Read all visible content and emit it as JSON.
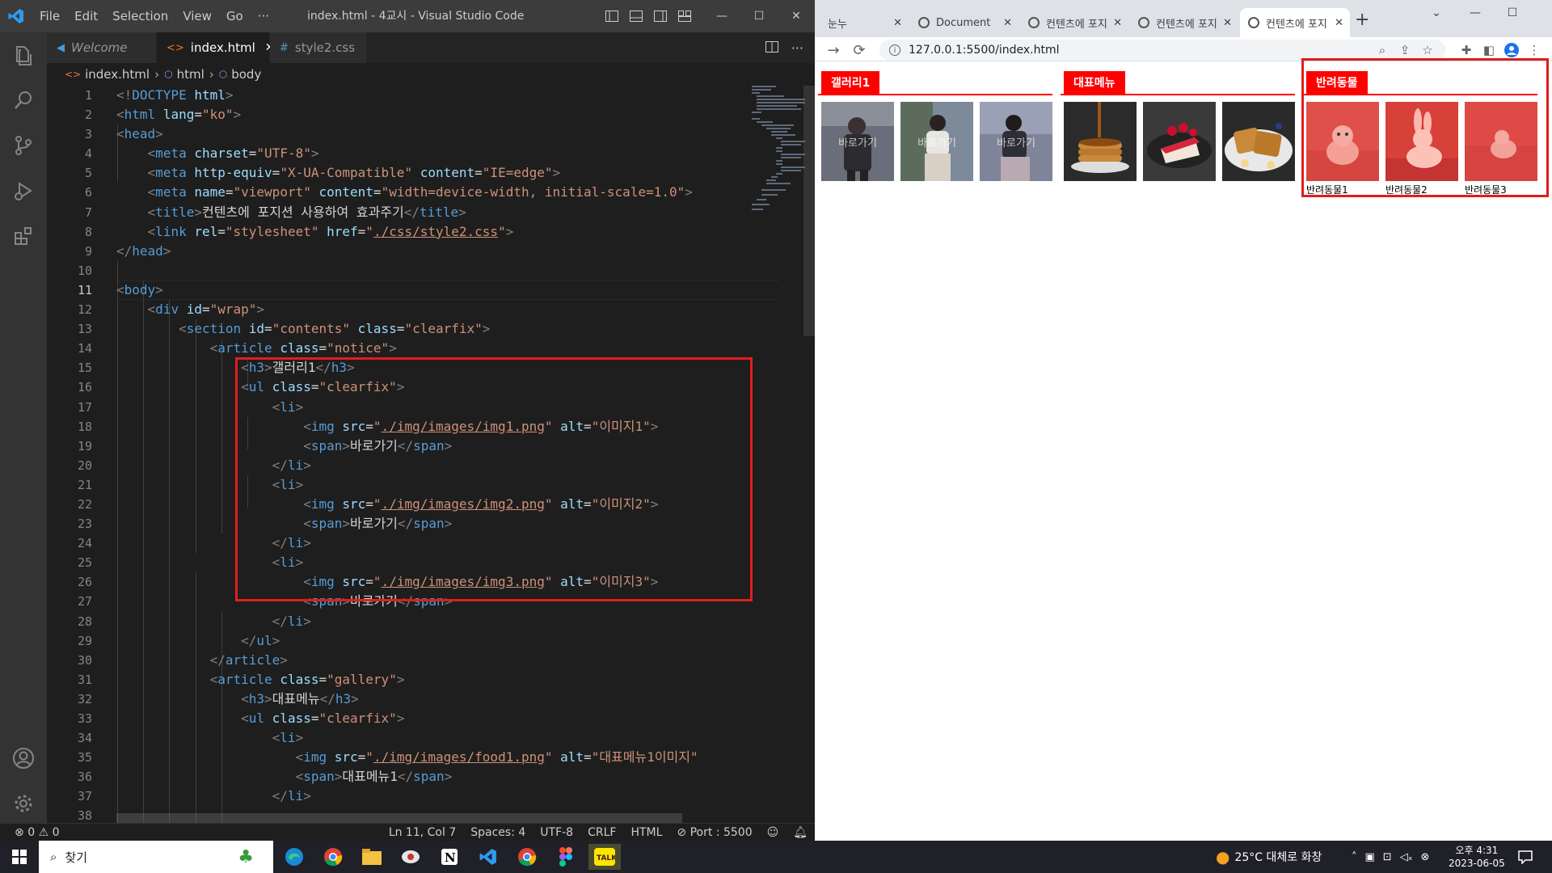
{
  "vscode": {
    "menu": [
      "File",
      "Edit",
      "Selection",
      "View",
      "Go",
      "···"
    ],
    "window_title": "index.html - 4교시 - Visual Studio Code",
    "tabs": [
      {
        "label": "Welcome"
      },
      {
        "label": "index.html"
      },
      {
        "label": "style2.css"
      }
    ],
    "breadcrumb": [
      "index.html",
      "html",
      "body"
    ],
    "line_numbers": [
      "1",
      "2",
      "3",
      "4",
      "5",
      "6",
      "7",
      "8",
      "9",
      "10",
      "11",
      "12",
      "13",
      "14",
      "15",
      "16",
      "17",
      "18",
      "19",
      "20",
      "21",
      "22",
      "23",
      "24",
      "25",
      "26",
      "27",
      "28",
      "29",
      "30",
      "31",
      "32",
      "33",
      "34",
      "35",
      "36",
      "37",
      "38"
    ],
    "code": {
      "l1a": "<!",
      "l1b": "DOCTYPE",
      "l1c": " html",
      "l1d": ">",
      "l2tag": "html",
      "l2attr": "lang",
      "l2val": "\"ko\"",
      "l3tag": "head",
      "l4tag": "meta",
      "l4attr": "charset",
      "l4val": "\"UTF-8\"",
      "l5tag": "meta",
      "l5attr1": "http-equiv",
      "l5val1": "\"X-UA-Compatible\"",
      "l5attr2": "content",
      "l5val2": "\"IE=edge\"",
      "l6tag": "meta",
      "l6attr1": "name",
      "l6val1": "\"viewport\"",
      "l6attr2": "content",
      "l6val2": "\"width=device-width, initial-scale=1.0\"",
      "l7tag": "title",
      "l7text": "컨텐츠에 포지션 사용하여 효과주기",
      "l8tag": "link",
      "l8attr1": "rel",
      "l8val1": "\"stylesheet\"",
      "l8attr2": "href",
      "l8val2": "./css/style2.css",
      "l9tag": "head",
      "l11tag": "body",
      "l12tag": "div",
      "l12attr": "id",
      "l12val": "\"wrap\"",
      "l13tag": "section",
      "l13attr1": "id",
      "l13val1": "\"contents\"",
      "l13attr2": "class",
      "l13val2": "\"clearfix\"",
      "l14tag": "article",
      "l14attr": "class",
      "l14val": "\"notice\"",
      "l15tag": "h3",
      "l15text": "갤러리1",
      "l16tag": "ul",
      "l16attr": "class",
      "l16val": "\"clearfix\"",
      "li": "li",
      "img": "img",
      "src": "src",
      "alt": "alt",
      "span": "span",
      "img1src": "./img/images/img1.png",
      "img1alt": "\"이미지1\"",
      "img2src": "./img/images/img2.png",
      "img2alt": "\"이미지2\"",
      "img3src": "./img/images/img3.png",
      "img3alt": "\"이미지3\"",
      "spantext": "바로가기",
      "l29tag": "ul",
      "l30tag": "article",
      "l31tag": "article",
      "l31attr": "class",
      "l31val": "\"gallery\"",
      "l32tag": "h3",
      "l32text": "대표메뉴",
      "l33tag": "ul",
      "l33attr": "class",
      "l33val": "\"clearfix\"",
      "food1src": "./img/images/food1.png",
      "food1alt": "\"대표메뉴1이미지\"",
      "l36text": "대표메뉴1"
    },
    "status": {
      "errors": "0",
      "warnings": "0",
      "position": "Ln 11, Col 7",
      "spaces": "Spaces: 4",
      "encoding": "UTF-8",
      "eol": "CRLF",
      "language": "HTML",
      "port": "Port : 5500"
    }
  },
  "browser": {
    "tabs": [
      {
        "label": "눈누"
      },
      {
        "label": "Document"
      },
      {
        "label": "컨텐츠에 포지"
      },
      {
        "label": "컨텐츠에 포지"
      },
      {
        "label": "컨텐츠에 포지"
      }
    ],
    "url": "127.0.0.1:5500/index.html",
    "page": {
      "gallery_title": "갤러리1",
      "gallery_overlay": "바로가기",
      "menu_title": "대표메뉴",
      "pet_title": "반려동물",
      "pet_captions": [
        "반려동물1",
        "반려동물2",
        "반려동물3"
      ]
    }
  },
  "taskbar": {
    "search_placeholder": "찾기",
    "weather": "25°C  대체로 화창",
    "time": "오후 4:31",
    "date": "2023-06-05"
  }
}
